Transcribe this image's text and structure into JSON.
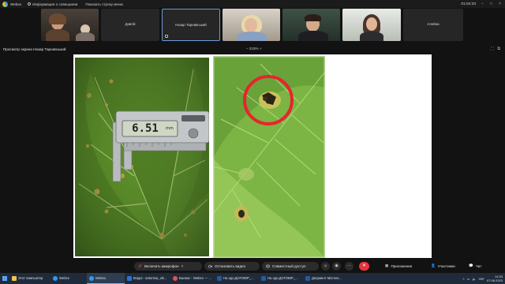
{
  "topbar": {
    "app_name": "Webex",
    "meeting_info": "Информация о совещании",
    "show_strip": "Показать строку меню",
    "clock": "01:04:33"
  },
  "participants": [
    {
      "name": "",
      "type": "video-woman"
    },
    {
      "name": "Довгій",
      "type": "name"
    },
    {
      "name": "Назар Тарнавський",
      "type": "name",
      "active": true
    },
    {
      "name": "",
      "type": "video-blonde"
    },
    {
      "name": "",
      "type": "video-man"
    },
    {
      "name": "",
      "type": "video-young-woman"
    },
    {
      "name": "Алейна",
      "type": "name"
    }
  ],
  "share": {
    "viewer_label": "Просмотр экрана Назар Тарнавський",
    "zoom": "215%"
  },
  "slide": {
    "caliper_reading": "6.51",
    "caliper_unit": "mm"
  },
  "controls": {
    "mute": "Включить микрофон",
    "video": "Остановить видео",
    "share": "Совместный доступ",
    "more": "···",
    "apps": "Приложения",
    "participants": "Участники",
    "chat": "Чат"
  },
  "taskbar": {
    "items": [
      {
        "label": "Этот компьютер",
        "color": "#f0c24b"
      },
      {
        "label": "Webex",
        "color": "#2d9bf0"
      },
      {
        "label": "Webex",
        "color": "#2d9bf0",
        "active": true
      },
      {
        "label": "Вхідні - antonina_vik...",
        "color": "#2f6fd6"
      },
      {
        "label": "Баланс - Webex — ...",
        "color": "#e0544c"
      },
      {
        "label": "На одн.ДОГОВІР_...",
        "color": "#2b579a"
      },
      {
        "label": "На одн.ДОГОВІР_...",
        "color": "#2b579a"
      },
      {
        "label": "Документ Microso...",
        "color": "#2b579a"
      }
    ],
    "lang": "УКР",
    "time": "11:33",
    "date": "07.06.2023"
  },
  "colors": {
    "end_call": "#e5343c",
    "active_tile_border": "#6e9bd6",
    "highlight_circle": "#e8242c"
  }
}
